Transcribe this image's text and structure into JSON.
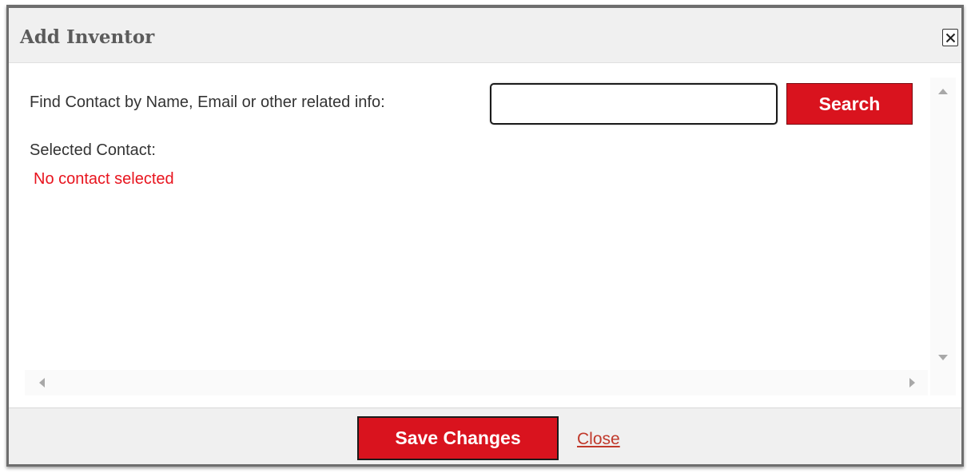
{
  "dialog": {
    "title": "Add Inventor",
    "close_icon": "close-x-icon"
  },
  "search": {
    "label": "Find Contact by Name, Email or other related info:",
    "input_value": "",
    "input_placeholder": "",
    "button_label": "Search"
  },
  "selection": {
    "label": "Selected Contact:",
    "status": "No contact selected"
  },
  "footer": {
    "save_label": "Save Changes",
    "close_label": "Close"
  },
  "colors": {
    "accent": "#d9131e",
    "status_text": "#e8141e",
    "link": "#c0392b"
  }
}
